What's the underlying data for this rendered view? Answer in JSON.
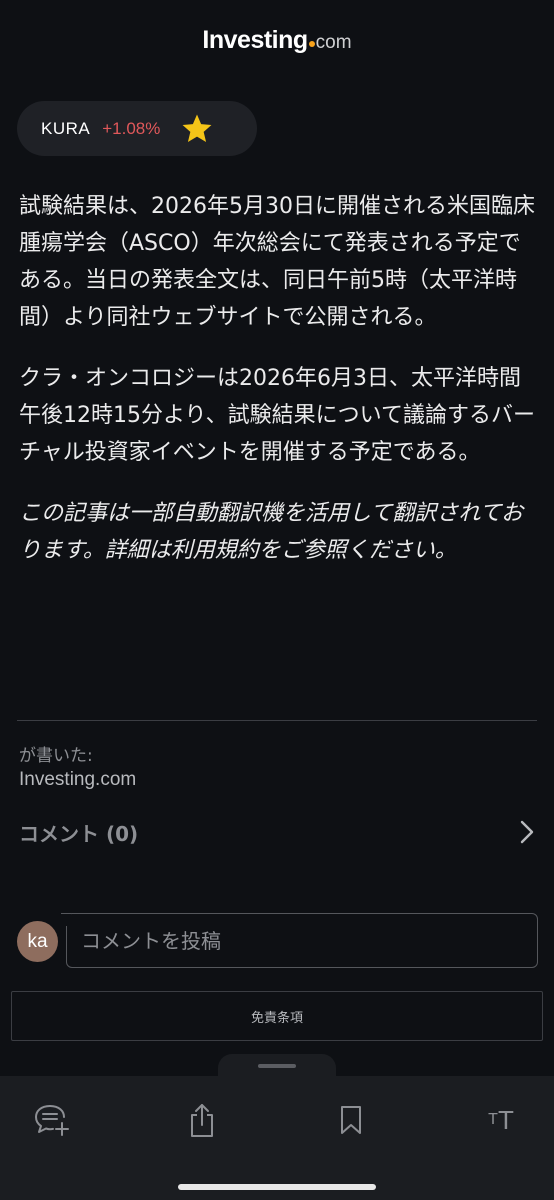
{
  "header": {
    "logo_main": "Investing",
    "logo_suffix": "com"
  },
  "ticker": {
    "symbol": "KURA",
    "change": "+1.08%",
    "change_color": "#e0585a",
    "star_color": "#f5c518"
  },
  "article": {
    "paragraphs": [
      "試験結果は、2026年5月30日に開催される米国臨床腫瘍学会（ASCO）年次総会にて発表される予定である。当日の発表全文は、同日午前5時（太平洋時間）より同社ウェブサイトで公開される。",
      "クラ・オンコロジーは2026年6月3日、太平洋時間午後12時15分より、試験結果について議論するバーチャル投資家イベントを開催する予定である。"
    ],
    "translation_note": "この記事は一部自動翻訳機を活用して翻訳されております。詳細は利用規約をご参照ください。"
  },
  "byline": {
    "label": "が書いた:",
    "source": "Investing.com"
  },
  "comments": {
    "label": "コメント (0)",
    "avatar_initials": "ka",
    "input_placeholder": "コメントを投稿"
  },
  "disclaimer": {
    "label": "免責条項"
  },
  "toolbar": {
    "icons": [
      "comment-add-icon",
      "share-icon",
      "bookmark-icon",
      "text-size-icon"
    ],
    "text_size_glyph_small": "T",
    "text_size_glyph_large": "T"
  }
}
